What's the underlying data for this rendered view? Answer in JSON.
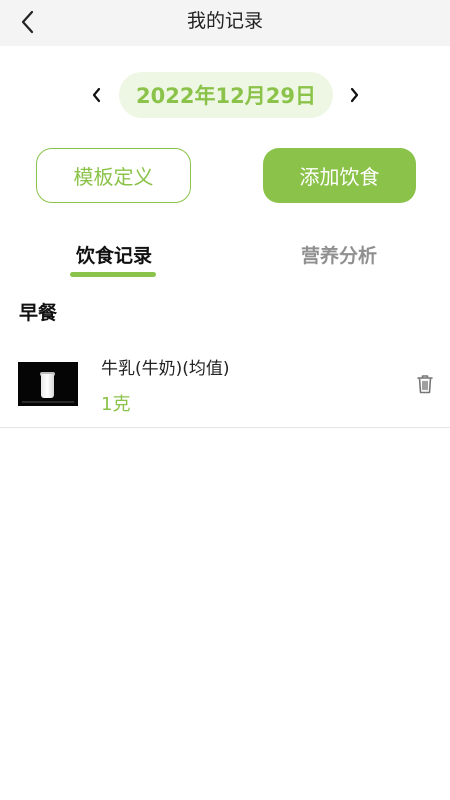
{
  "header": {
    "title": "我的记录",
    "back_icon": "chevron-left-icon"
  },
  "date_nav": {
    "date": "2022年12月29日",
    "prev_icon": "chevron-left-icon",
    "next_icon": "chevron-right-icon"
  },
  "actions": {
    "template_label": "模板定义",
    "add_food_label": "添加饮食"
  },
  "tabs": [
    {
      "label": "饮食记录",
      "active": true
    },
    {
      "label": "营养分析",
      "active": false
    }
  ],
  "colors": {
    "accent": "#8bc34a",
    "accent_light": "#eef6e4",
    "header_bg": "#f4f4f4"
  },
  "meals": [
    {
      "title": "早餐",
      "items": [
        {
          "name": "牛乳(牛奶)(均值)",
          "quantity": "1克",
          "image": "milk-glass-photo",
          "delete_icon": "trash-icon"
        }
      ]
    }
  ]
}
